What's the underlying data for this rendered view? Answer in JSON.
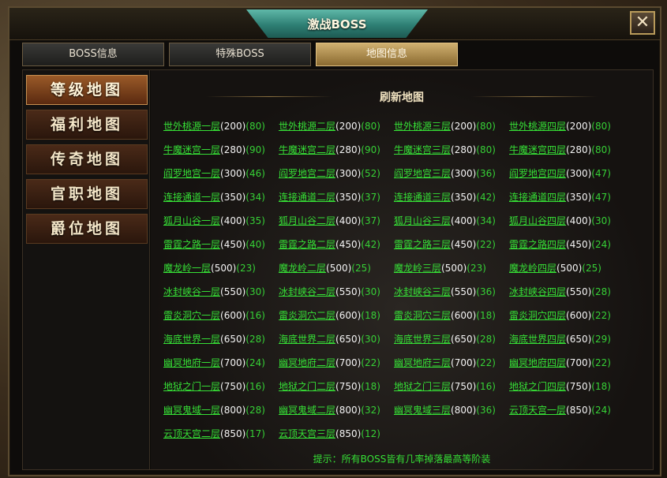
{
  "window": {
    "title": "激战BOSS",
    "close_label": "✕"
  },
  "tabs": [
    {
      "label": "BOSS信息",
      "active": false
    },
    {
      "label": "特殊BOSS",
      "active": false
    },
    {
      "label": "地图信息",
      "active": true
    }
  ],
  "sidebar": {
    "items": [
      {
        "label": "等级地图",
        "active": true
      },
      {
        "label": "福利地图",
        "active": false
      },
      {
        "label": "传奇地图",
        "active": false
      },
      {
        "label": "官职地图",
        "active": false
      },
      {
        "label": "爵位地图",
        "active": false
      }
    ]
  },
  "main": {
    "header": "刷新地图",
    "tip": "提示：所有BOSS皆有几率掉落最高等阶装",
    "maps": [
      [
        {
          "name": "世外桃源一层",
          "level": "(200)",
          "count": "(80)"
        },
        {
          "name": "世外桃源二层",
          "level": "(200)",
          "count": "(80)"
        },
        {
          "name": "世外桃源三层",
          "level": "(200)",
          "count": "(80)"
        },
        {
          "name": "世外桃源四层",
          "level": "(200)",
          "count": "(80)"
        }
      ],
      [
        {
          "name": "牛魔迷宫一层",
          "level": "(280)",
          "count": "(90)"
        },
        {
          "name": "牛魔迷宫二层",
          "level": "(280)",
          "count": "(90)"
        },
        {
          "name": "牛魔迷宫三层",
          "level": "(280)",
          "count": "(80)"
        },
        {
          "name": "牛魔迷宫四层",
          "level": "(280)",
          "count": "(80)"
        }
      ],
      [
        {
          "name": "阎罗地宫一层",
          "level": "(300)",
          "count": "(46)"
        },
        {
          "name": "阎罗地宫二层",
          "level": "(300)",
          "count": "(52)"
        },
        {
          "name": "阎罗地宫三层",
          "level": "(300)",
          "count": "(36)"
        },
        {
          "name": "阎罗地宫四层",
          "level": "(300)",
          "count": "(47)"
        }
      ],
      [
        {
          "name": "连接通道一层",
          "level": "(350)",
          "count": "(34)"
        },
        {
          "name": "连接通道二层",
          "level": "(350)",
          "count": "(37)"
        },
        {
          "name": "连接通道三层",
          "level": "(350)",
          "count": "(42)"
        },
        {
          "name": "连接通道四层",
          "level": "(350)",
          "count": "(47)"
        }
      ],
      [
        {
          "name": "狐月山谷一层",
          "level": "(400)",
          "count": "(35)"
        },
        {
          "name": "狐月山谷二层",
          "level": "(400)",
          "count": "(37)"
        },
        {
          "name": "狐月山谷三层",
          "level": "(400)",
          "count": "(34)"
        },
        {
          "name": "狐月山谷四层",
          "level": "(400)",
          "count": "(30)"
        }
      ],
      [
        {
          "name": "雷霆之路一层",
          "level": "(450)",
          "count": "(40)"
        },
        {
          "name": "雷霆之路二层",
          "level": "(450)",
          "count": "(42)"
        },
        {
          "name": "雷霆之路三层",
          "level": "(450)",
          "count": "(22)"
        },
        {
          "name": "雷霆之路四层",
          "level": "(450)",
          "count": "(24)"
        }
      ],
      [
        {
          "name": "魔龙岭一层",
          "level": "(500)",
          "count": "(23)"
        },
        {
          "name": "魔龙岭二层",
          "level": "(500)",
          "count": "(25)"
        },
        {
          "name": "魔龙岭三层",
          "level": "(500)",
          "count": "(23)"
        },
        {
          "name": "魔龙岭四层",
          "level": "(500)",
          "count": "(25)"
        }
      ],
      [
        {
          "name": "冰封峡谷一层",
          "level": "(550)",
          "count": "(30)"
        },
        {
          "name": "冰封峡谷二层",
          "level": "(550)",
          "count": "(30)"
        },
        {
          "name": "冰封峡谷三层",
          "level": "(550)",
          "count": "(36)"
        },
        {
          "name": "冰封峡谷四层",
          "level": "(550)",
          "count": "(28)"
        }
      ],
      [
        {
          "name": "雷炎洞穴一层",
          "level": "(600)",
          "count": "(16)"
        },
        {
          "name": "雷炎洞穴二层",
          "level": "(600)",
          "count": "(18)"
        },
        {
          "name": "雷炎洞穴三层",
          "level": "(600)",
          "count": "(18)"
        },
        {
          "name": "雷炎洞穴四层",
          "level": "(600)",
          "count": "(22)"
        }
      ],
      [
        {
          "name": "海底世界一层",
          "level": "(650)",
          "count": "(28)"
        },
        {
          "name": "海底世界二层",
          "level": "(650)",
          "count": "(30)"
        },
        {
          "name": "海底世界三层",
          "level": "(650)",
          "count": "(28)"
        },
        {
          "name": "海底世界四层",
          "level": "(650)",
          "count": "(29)"
        }
      ],
      [
        {
          "name": "幽冥地府一层",
          "level": "(700)",
          "count": "(24)"
        },
        {
          "name": "幽冥地府二层",
          "level": "(700)",
          "count": "(22)"
        },
        {
          "name": "幽冥地府三层",
          "level": "(700)",
          "count": "(22)"
        },
        {
          "name": "幽冥地府四层",
          "level": "(700)",
          "count": "(22)"
        }
      ],
      [
        {
          "name": "地狱之门一层",
          "level": "(750)",
          "count": "(16)"
        },
        {
          "name": "地狱之门二层",
          "level": "(750)",
          "count": "(18)"
        },
        {
          "name": "地狱之门三层",
          "level": "(750)",
          "count": "(16)"
        },
        {
          "name": "地狱之门四层",
          "level": "(750)",
          "count": "(18)"
        }
      ],
      [
        {
          "name": "幽冥鬼域一层",
          "level": "(800)",
          "count": "(28)"
        },
        {
          "name": "幽冥鬼域二层",
          "level": "(800)",
          "count": "(32)"
        },
        {
          "name": "幽冥鬼域三层",
          "level": "(800)",
          "count": "(36)"
        },
        {
          "name": "云顶天宫一层",
          "level": "(850)",
          "count": "(24)"
        }
      ],
      [
        {
          "name": "云顶天宫二层",
          "level": "(850)",
          "count": "(17)"
        },
        {
          "name": "云顶天宫三层",
          "level": "(850)",
          "count": "(12)"
        }
      ]
    ]
  }
}
